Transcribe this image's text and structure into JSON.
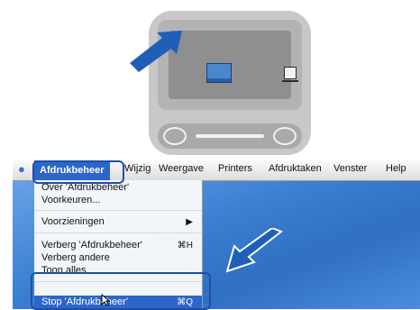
{
  "menubar": {
    "active_menu": "Afdrukbeheer",
    "items": [
      "Wijzig",
      "Weergave",
      "Printers",
      "Afdruktaken",
      "Venster",
      "Help"
    ]
  },
  "dropdown": {
    "items": [
      {
        "label": "Over 'Afdrukbeheer'",
        "shortcut": ""
      },
      {
        "label": "Voorkeuren...",
        "shortcut": ""
      },
      {
        "label": "Voorzieningen",
        "shortcut": "▶"
      },
      {
        "label": "Verberg 'Afdrukbeheer'",
        "shortcut": "⌘H"
      },
      {
        "label": "Verberg andere",
        "shortcut": ""
      },
      {
        "label": "Toon alles",
        "shortcut": ""
      },
      {
        "label": "Stop 'Afdrukbeheer'",
        "shortcut": "⌘Q"
      }
    ]
  },
  "colors": {
    "arrow": "#1f5fb8",
    "highlight": "#2c66c9"
  }
}
